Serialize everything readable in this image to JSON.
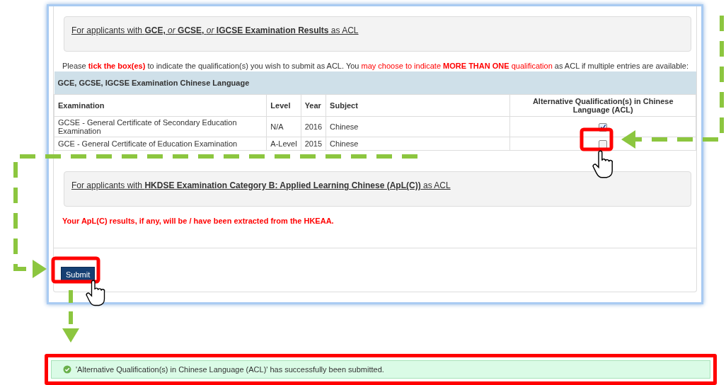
{
  "panels": [
    {
      "heading": "For applicants with **GCE,** *or* **GCSE,** *or* **IGCSE Examination Results** as ACL"
    }
  ],
  "instruction": [
    {
      "kind": "plain",
      "text": "Please "
    },
    {
      "kind": "alert-strong",
      "text": "tick the box(es)"
    },
    {
      "kind": "plain",
      "text": " to indicate the qualification(s) you wish to submit as ACL. You "
    },
    {
      "kind": "alert",
      "text": "may choose to indicate "
    },
    {
      "kind": "alert-strong",
      "text": "MORE THAN ONE"
    },
    {
      "kind": "alert",
      "text": " qualification"
    },
    {
      "kind": "plain",
      "text": " as ACL if multiple entries are available:"
    }
  ],
  "table": {
    "caption": "GCE, GCSE, IGCSE Examination Chinese Language",
    "columns": [
      "Examination",
      "Level",
      "Year",
      "Subject",
      "Alternative Qualification(s) in Chinese Language (ACL)"
    ],
    "rows": [
      {
        "examination": "GCSE - General Certificate of Secondary Education Examination",
        "level": "N/A",
        "year": "2016",
        "subject": "Chinese",
        "checked": true
      },
      {
        "examination": "GCE - General Certificate of Education Examination",
        "level": "A-Level",
        "year": "2015",
        "subject": "Chinese",
        "checked": false
      }
    ]
  },
  "apl_panel": {
    "heading": "For applicants with **HKDSE Examination Category B: Applied Learning Chinese (ApL(C))** as ACL"
  },
  "apl_note": "Your ApL(C) results, if any, will be / have been extracted from the HKEAA.",
  "submit_button": "Submit",
  "success_message": "'Alternative Qualification(s) in Chinese Language (ACL)' has successfully been submitted."
}
